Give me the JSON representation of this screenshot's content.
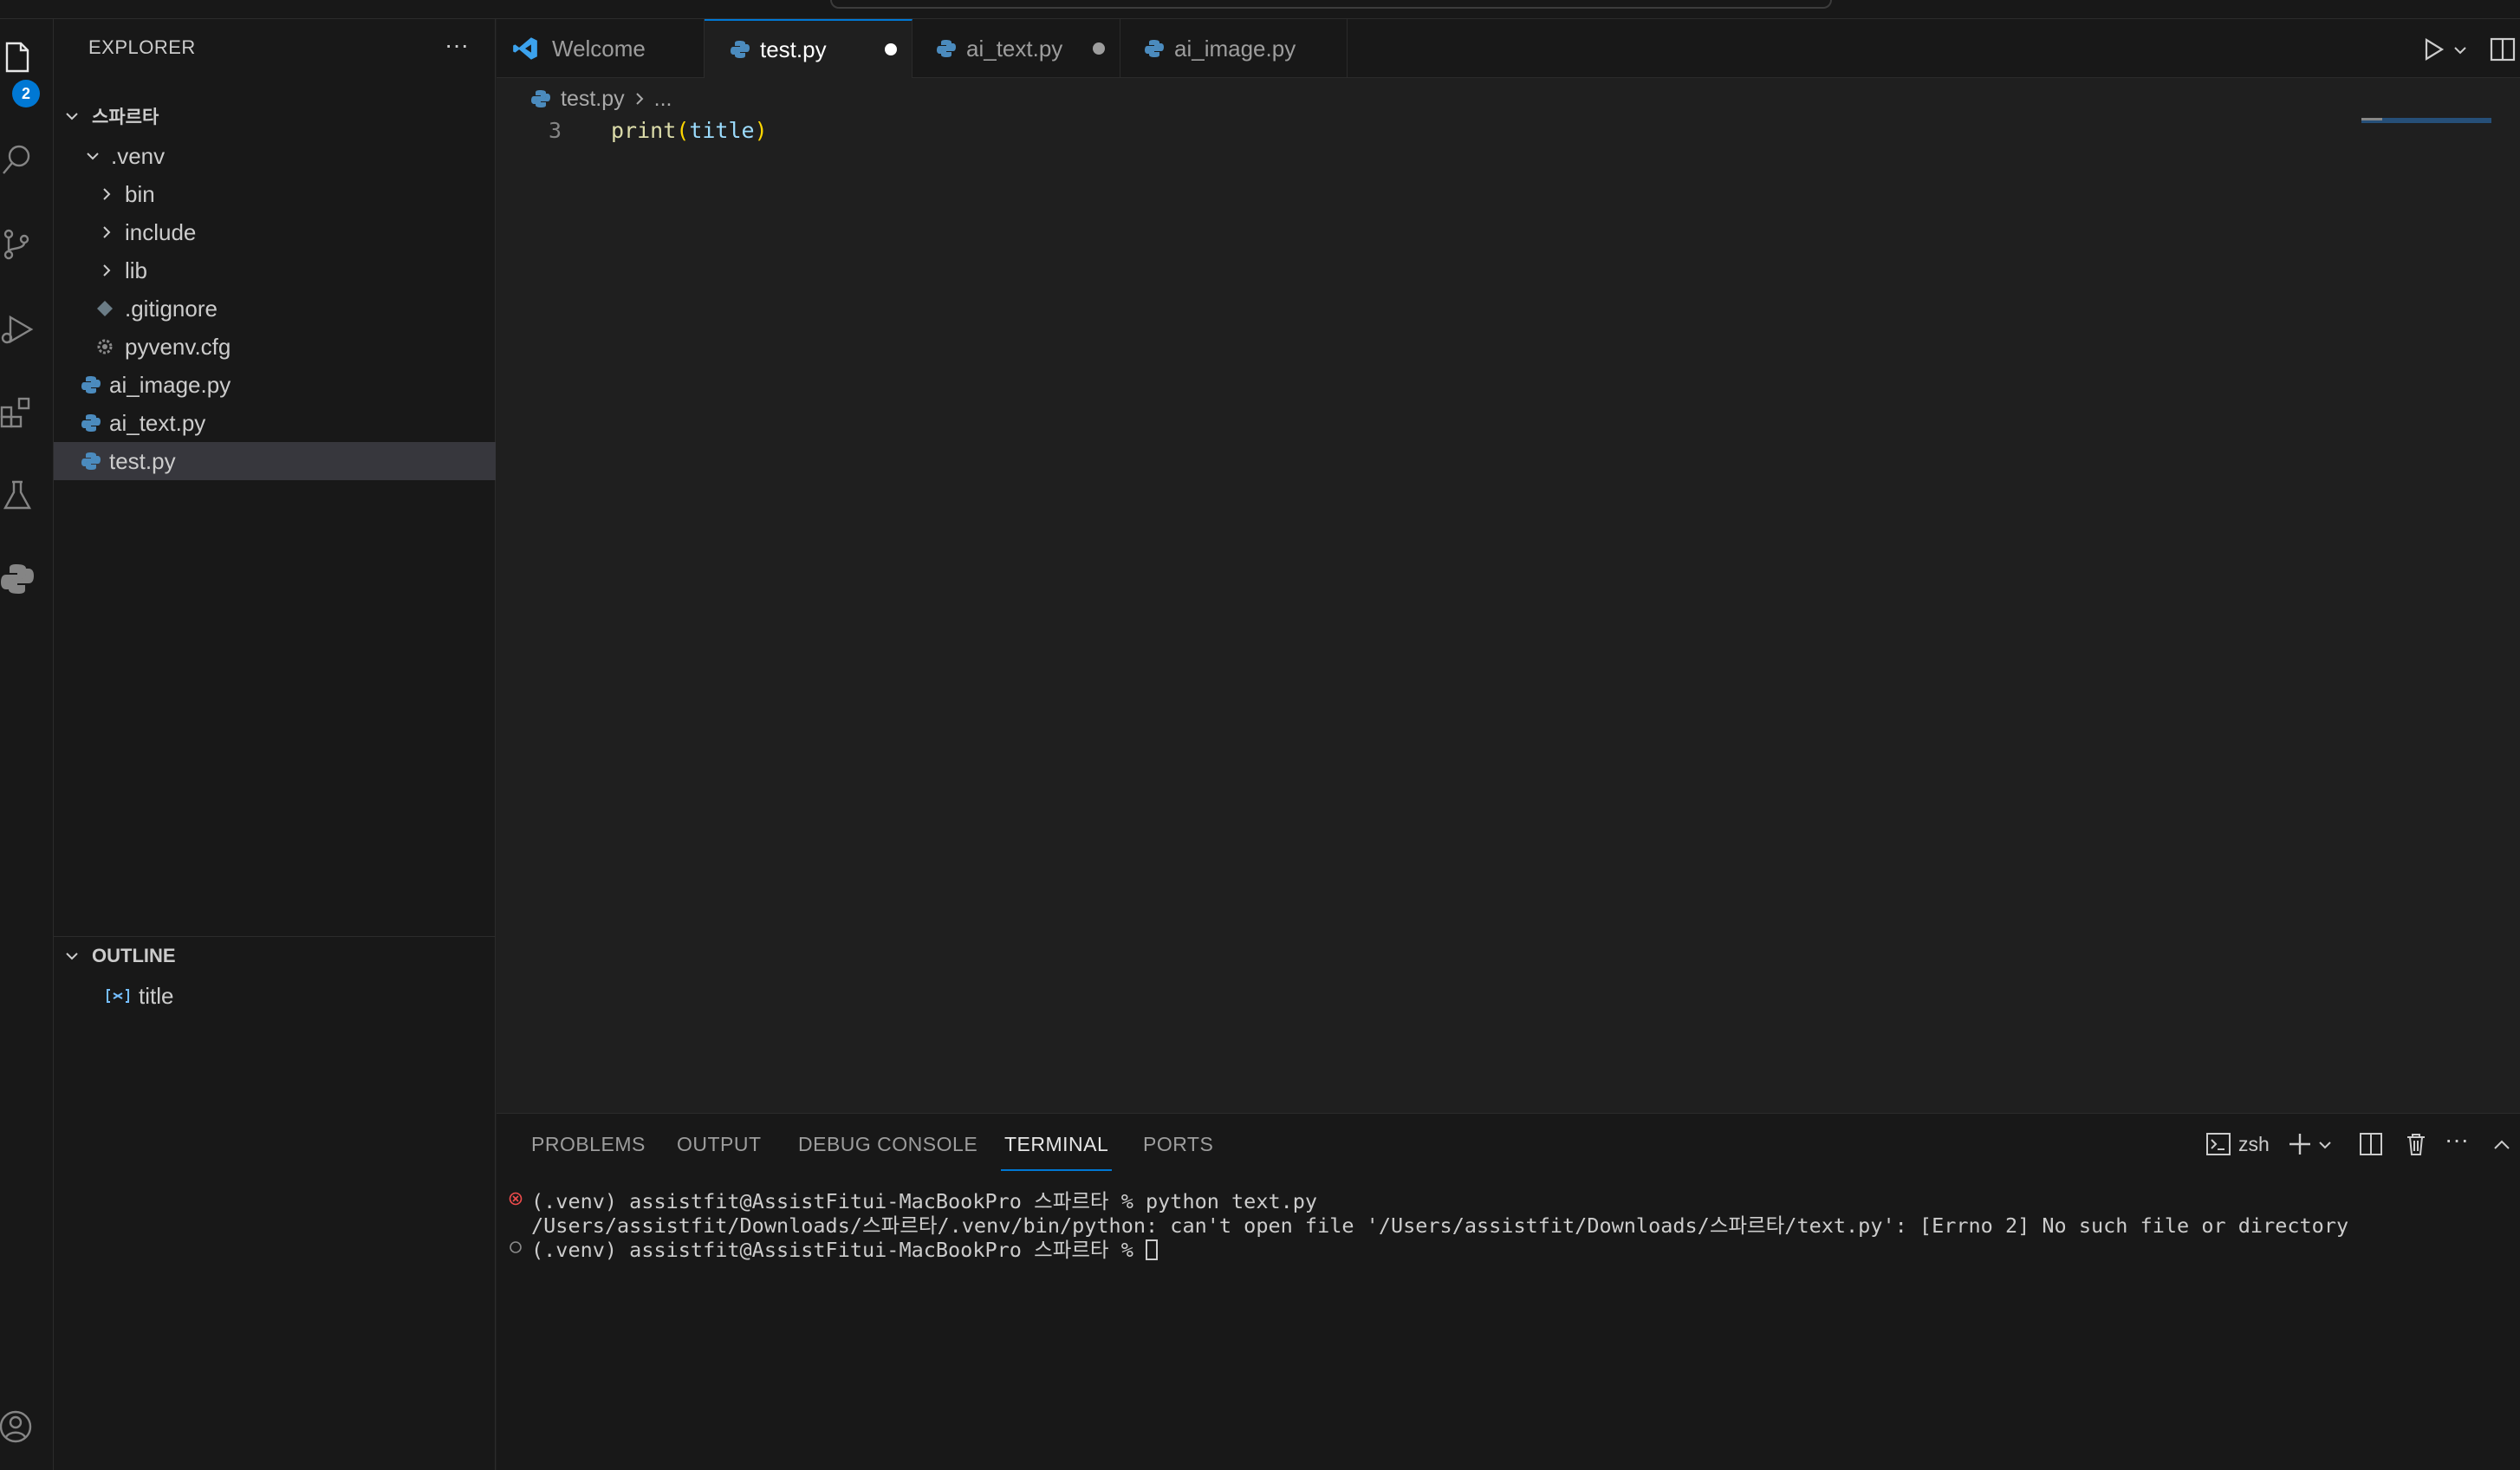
{
  "activity": {
    "badge": "2"
  },
  "explorer": {
    "title": "EXPLORER",
    "more": "···",
    "root": "스파르타",
    "items": [
      {
        "label": ".venv"
      },
      {
        "label": "bin"
      },
      {
        "label": "include"
      },
      {
        "label": "lib"
      },
      {
        "label": ".gitignore"
      },
      {
        "label": "pyvenv.cfg"
      },
      {
        "label": "ai_image.py"
      },
      {
        "label": "ai_text.py"
      },
      {
        "label": "test.py"
      }
    ]
  },
  "outline": {
    "title": "OUTLINE",
    "items": [
      {
        "label": "title"
      }
    ]
  },
  "tabs": [
    {
      "label": "Welcome"
    },
    {
      "label": "test.py"
    },
    {
      "label": "ai_text.py"
    },
    {
      "label": "ai_image.py"
    }
  ],
  "breadcrumb": {
    "file": "test.py",
    "rest": "..."
  },
  "editor": {
    "line_number": "3",
    "fn": "print",
    "open": "(",
    "arg": "title",
    "close": ")"
  },
  "panel": {
    "tabs": [
      "PROBLEMS",
      "OUTPUT",
      "DEBUG CONSOLE",
      "TERMINAL",
      "PORTS"
    ],
    "shell": "zsh",
    "lines": [
      "(.venv) assistfit@AssistFitui-MacBookPro 스파르타 % python text.py",
      "/Users/assistfit/Downloads/스파르타/.venv/bin/python: can't open file '/Users/assistfit/Downloads/스파르타/text.py': [Errno 2] No such file or directory",
      "(.venv) assistfit@AssistFitui-MacBookPro 스파르타 % "
    ]
  },
  "colors": {
    "accent": "#0078d4",
    "python": "#4b8bbe",
    "fn": "#dcdcaa",
    "var": "#9cdcfe",
    "error": "#f14c4c"
  }
}
